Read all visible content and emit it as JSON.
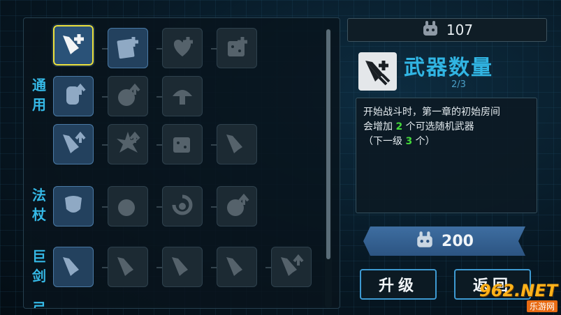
{
  "currency": {
    "icon": "bunny-token-icon",
    "amount": "107"
  },
  "categories": [
    {
      "label": "通用"
    },
    {
      "label": "法杖"
    },
    {
      "label": "巨剑"
    },
    {
      "label": "弓"
    }
  ],
  "skills": [
    {
      "icon": "weapon-plus-icon",
      "state": "selected"
    },
    {
      "icon": "card-plus-icon",
      "state": "unlocked"
    },
    {
      "icon": "heart-plus-icon",
      "state": "locked"
    },
    {
      "icon": "chest-plus-icon",
      "state": "locked"
    },
    {
      "icon": "scroll-upgrade-icon",
      "state": "unlocked"
    },
    {
      "icon": "bomb-upgrade-icon",
      "state": "locked"
    },
    {
      "icon": "mushroom-icon",
      "state": "locked"
    },
    {
      "icon": "weapon-upgrade-icon",
      "state": "unlocked"
    },
    {
      "icon": "burst-upgrade-icon",
      "state": "locked"
    },
    {
      "icon": "dice-icon",
      "state": "locked"
    },
    {
      "icon": "flame-sword-icon",
      "state": "locked"
    },
    {
      "icon": "staff-shield-icon",
      "state": "unlocked"
    },
    {
      "icon": "orb-icon",
      "state": "locked"
    },
    {
      "icon": "swirl-icon",
      "state": "locked"
    },
    {
      "icon": "orb-upgrade-icon",
      "state": "locked"
    },
    {
      "icon": "greatsword-icon",
      "state": "unlocked"
    },
    {
      "icon": "sword-slash-icon",
      "state": "locked"
    },
    {
      "icon": "sword-crescent-icon",
      "state": "locked"
    },
    {
      "icon": "sword-spin-icon",
      "state": "locked"
    },
    {
      "icon": "sword-upgrade-icon",
      "state": "locked"
    }
  ],
  "detail": {
    "icon": "weapon-plus-icon",
    "title": "武器数量",
    "level": "2/3",
    "desc_line1": "开始战斗时，第一章的初始房间",
    "desc_line2_pre": "会增加 ",
    "desc_line2_num": "2",
    "desc_line2_post": " 个可选随机武器",
    "desc_line3_pre": "（下一级 ",
    "desc_line3_num": "3",
    "desc_line3_post": " 个）"
  },
  "cost": {
    "icon": "bunny-token-icon",
    "amount": "200"
  },
  "buttons": {
    "upgrade": "升级",
    "back": "返回"
  },
  "watermark": {
    "main": "962.NET",
    "sub": "乐游网"
  },
  "colors": {
    "accent": "#31b5e3",
    "highlight": "#44d83b",
    "selected_border": "#ece13d"
  }
}
